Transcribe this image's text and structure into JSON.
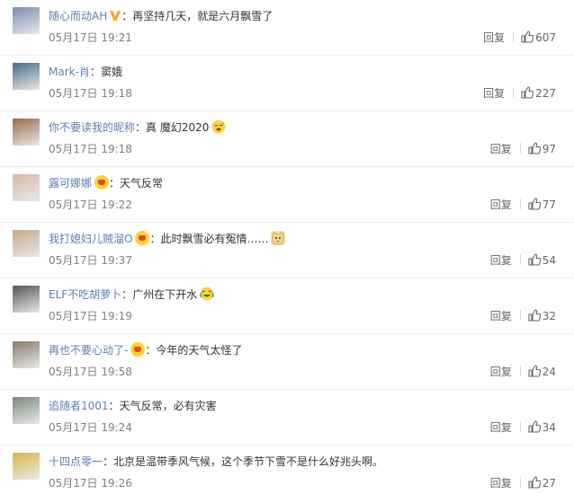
{
  "comments": [
    {
      "user": "随心而动AH",
      "badge": "v-badge",
      "text": "再坚持几天，就是六月飘雪了",
      "emoji": null,
      "time": "05月17日 19:21",
      "reply": "回复",
      "likes": "607",
      "avatar_color": "#7a8fb3"
    },
    {
      "user": "Mark-肖",
      "badge": null,
      "text": "窦娥",
      "emoji": null,
      "time": "05月17日 19:18",
      "reply": "回复",
      "likes": "227",
      "avatar_color": "#4a6a8a"
    },
    {
      "user": "你不要读我的昵称",
      "badge": null,
      "text": "真 魔幻2020",
      "emoji": "sweat-emoji",
      "time": "05月17日 19:18",
      "reply": "回复",
      "likes": "97",
      "avatar_color": "#9a6a4a"
    },
    {
      "user": "露可娜娜",
      "badge": "crown-badge",
      "text": "天气反常",
      "emoji": null,
      "time": "05月17日 19:22",
      "reply": "回复",
      "likes": "77",
      "avatar_color": "#d8b8a8"
    },
    {
      "user": "我打媳妇儿贼溜O",
      "badge": "crown-badge",
      "text": "此时飘雪必有冤情……",
      "emoji": "cat-emoji",
      "time": "05月17日 19:37",
      "reply": "回复",
      "likes": "54",
      "avatar_color": "#c8a888"
    },
    {
      "user": "ELF不吃胡萝卜",
      "badge": null,
      "text": "广州在下开水",
      "emoji": "laugh-cry-emoji",
      "time": "05月17日 19:19",
      "reply": "回复",
      "likes": "32",
      "avatar_color": "#555555"
    },
    {
      "user": "再也不要心动了-",
      "badge": "crown-badge",
      "text": "今年的天气太怪了",
      "emoji": null,
      "time": "05月17日 19:58",
      "reply": "回复",
      "likes": "24",
      "avatar_color": "#8a7a6a"
    },
    {
      "user": "追随者1001",
      "badge": null,
      "text": "天气反常，必有灾害",
      "emoji": null,
      "time": "05月17日 19:24",
      "reply": "回复",
      "likes": "34",
      "avatar_color": "#7a8a7a"
    },
    {
      "user": "十四点零一",
      "badge": null,
      "text": "北京是温带季风气候，这个季节下雪不是什么好兆头啊。",
      "emoji": null,
      "time": "05月17日 19:26",
      "reply": "回复",
      "likes": "27",
      "avatar_color": "#d8b848"
    }
  ]
}
